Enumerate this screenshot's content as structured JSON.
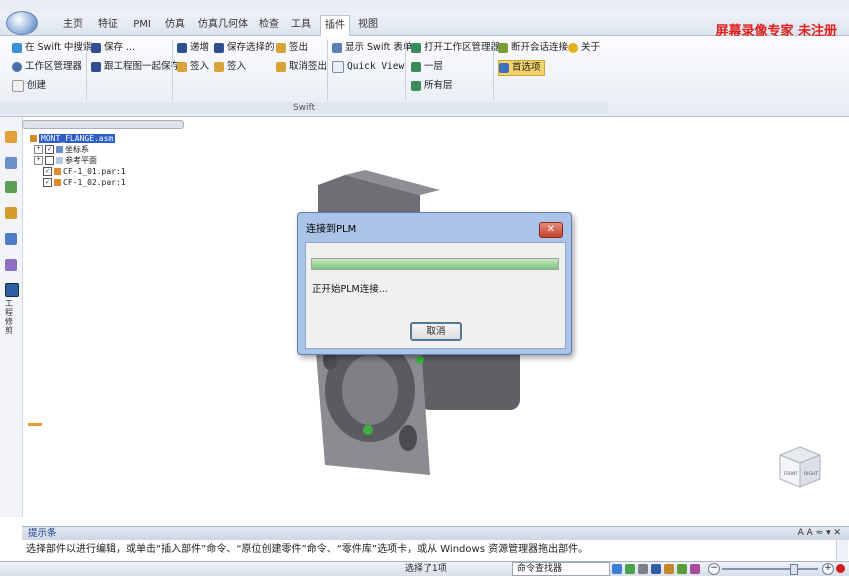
{
  "watermark": "屏幕录像专家 未注册",
  "tabs": [
    {
      "label": "主页"
    },
    {
      "label": "特征"
    },
    {
      "label": "PMI"
    },
    {
      "label": "仿真"
    },
    {
      "label": "仿真几何体"
    },
    {
      "label": "检查"
    },
    {
      "label": "工具"
    },
    {
      "label": "插件",
      "active": true
    },
    {
      "label": "视图"
    }
  ],
  "ribbon": {
    "items": {
      "search": "在 Swift 中搜索",
      "workspace": "工作区管理器",
      "create": "创建",
      "save": "保存 ...",
      "save_with_drawing": "跟工程图一起保存",
      "submit": "递增",
      "checkin": "签入",
      "save_selected": "保存选择的",
      "checkin2": "签入",
      "checkout": "签出",
      "cancel_checkout": "取消签出",
      "show_swift_form": "显示 Swift 表单",
      "quick_view": "Quick View",
      "open_workspace_manager": "打开工作区管理器",
      "one_level": "一层",
      "all_levels": "所有层",
      "disconnect": "断开会话连接",
      "about": "关于",
      "preferences": "首选项"
    },
    "group_label": "Swift"
  },
  "tree": {
    "root": "MONT_FLANGE.asm",
    "items": [
      "坐标系",
      "参考平面",
      "CF-1_01.par:1",
      "CF-1_02.par:1"
    ]
  },
  "side_tab_label": "工程修剪",
  "viewcube": {
    "front": "FRONT",
    "right": "RIGHT"
  },
  "dialog": {
    "title": "连接到PLM",
    "message": "正开始PLM连接...",
    "button": "取消",
    "close": "✕",
    "progress": 1.0
  },
  "hintbar": {
    "title": "提示条",
    "controls": "A A ≈ ▾ ✕",
    "text": "选择部件以进行编辑，或单击“插入部件”命令、“原位创建零件”命令、“零件库”选项卡，或从 Windows 资源管理器拖出部件。"
  },
  "statusbar": {
    "selection": "选择了1项",
    "command_finder": "命令查找器"
  }
}
